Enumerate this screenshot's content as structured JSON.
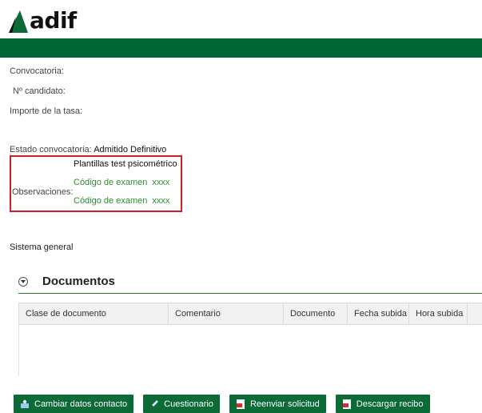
{
  "brand": {
    "name": "adif"
  },
  "fields": {
    "convocatoria_label": "Convocatoria:",
    "candidato_label": "Nº candidato:",
    "importe_label": "Importe de la tasa:",
    "estado_label": "Estado convocatoria:",
    "estado_value": "Admitido Definitivo"
  },
  "observaciones": {
    "label": "Observaciones:",
    "title": "Plantillas test psicométrico",
    "codes": [
      {
        "label": "Código de examen",
        "value": "xxxx"
      },
      {
        "label": "Código de examen",
        "value": "xxxx"
      }
    ]
  },
  "sistema": "Sistema general",
  "documentos": {
    "title": "Documentos",
    "columns": [
      "Clase de documento",
      "Comentario",
      "Documento",
      "Fecha subida",
      "Hora subida"
    ]
  },
  "buttons": [
    {
      "label": "Cambiar datos contacto",
      "icon": "contact-icon"
    },
    {
      "label": "Cuestionario",
      "icon": "pencil-icon"
    },
    {
      "label": "Reenviar solicitud",
      "icon": "pdf-icon"
    },
    {
      "label": "Descargar recibo",
      "icon": "pdf-icon"
    }
  ],
  "colors": {
    "brand_green": "#006837",
    "button_green": "#0b6b36",
    "highlight_red": "#d11f2a",
    "code_green": "#2e8b2e"
  }
}
